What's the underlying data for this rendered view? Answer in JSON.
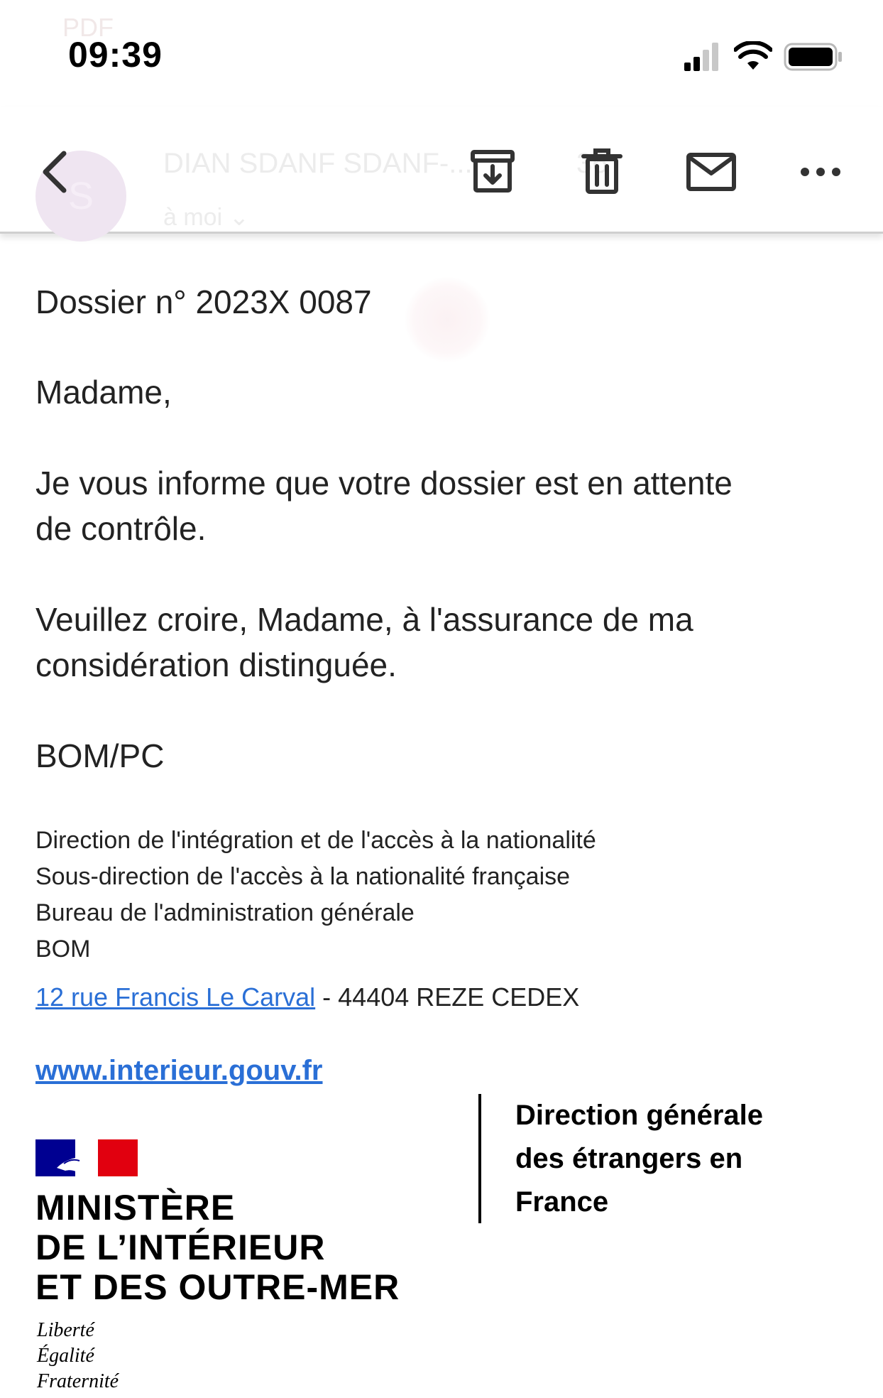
{
  "status_bar": {
    "time": "09:39",
    "ghost_label": "PDF",
    "icons": [
      "signal-icon",
      "wifi-icon",
      "battery-icon"
    ]
  },
  "header": {
    "ghost_avatar_letter": "S",
    "ghost_sender": "DIAN SDANF SDANF-...",
    "ghost_recipient": "à moi ⌄",
    "ghost_count": "36",
    "actions": [
      "back-icon",
      "archive-icon",
      "trash-icon",
      "mail-icon",
      "more-icon"
    ]
  },
  "message": {
    "dossier": "Dossier n° 2023X 0087",
    "greeting": "Madame,",
    "para1_line1": "Je vous informe que votre dossier est en attente",
    "para1_line2": "de contrôle.",
    "para2_line1": "Veuillez croire, Madame, à l'assurance de ma",
    "para2_line2": "considération distinguée.",
    "initials": "BOM/PC"
  },
  "signature": {
    "line1": "Direction de l'intégration et de l'accès à la nationalité",
    "line2": "Sous-direction de l'accès à la nationalité française",
    "line3": "Bureau de l'administration générale",
    "line4": "BOM",
    "address_link": "12 rue Francis Le Carval",
    "address_rest": " - 44404 REZE CEDEX",
    "website": "www.interieur.gouv.fr",
    "ministry_line1": "MINISTÈRE",
    "ministry_line2": "DE L’INTÉRIEUR",
    "ministry_line3": "ET DES OUTRE-MER",
    "motto_1": "Liberté",
    "motto_2": "Égalité",
    "motto_3": "Fraternité",
    "dg_line1": "Direction générale",
    "dg_line2": "des étrangers en",
    "dg_line3": "France"
  },
  "colors": {
    "link": "#2a6fd6",
    "flag_blue": "#000091",
    "flag_red": "#e1000f",
    "text": "#222222"
  }
}
